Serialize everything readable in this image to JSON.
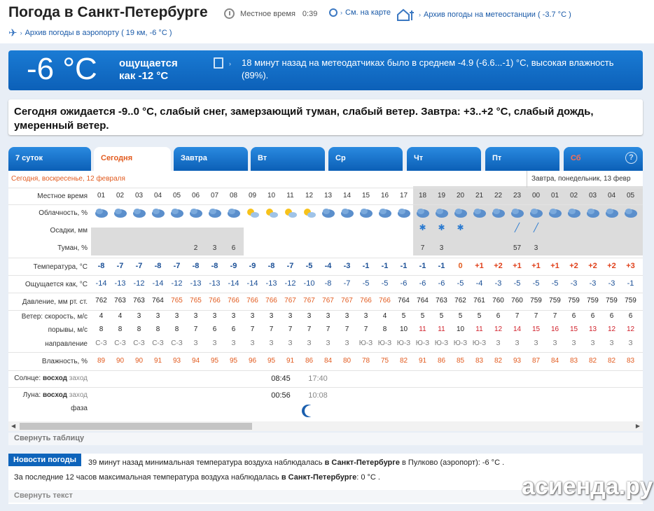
{
  "header": {
    "title": "Погода в Санкт-Петербурге",
    "local_time_label": "Местное время",
    "local_time": "0:39",
    "map_link": "См. на карте",
    "station_archive": "Архив погоды на метеостанции ( -3.7 °C )",
    "airport_archive": "Архив погоды в аэропорту ( 19 км, -6 °C )"
  },
  "current": {
    "temp": "-6 °C",
    "feels_1": "ощущается",
    "feels_2": "как -12 °C",
    "sensor_text": "18 минут назад на метеодатчиках было в среднем -4.9 (-6.6...-1) °C, высокая влажность (89%)."
  },
  "forecast_text": "Сегодня ожидается -9..0 °C, слабый снег, замерзающий туман, слабый ветер. Завтра: +3..+2 °C, слабый дождь, умеренный ветер.",
  "tabs": [
    {
      "label": "7 суток"
    },
    {
      "label": "Сегодня"
    },
    {
      "label": "Завтра"
    },
    {
      "label": "Вт"
    },
    {
      "label": "Ср"
    },
    {
      "label": "Чт"
    },
    {
      "label": "Пт"
    },
    {
      "label": "Сб"
    }
  ],
  "help_icon": "?",
  "day_today": "Сегодня, воскресенье, 12 февраля",
  "day_tomorrow": "Завтра, понедельник, 13 февр",
  "row_labels": {
    "time": "Местное время",
    "cloud": "Облачность, %",
    "precip": "Осадки, мм",
    "fog": "Туман, %",
    "temp": "Температура, °C",
    "feels": "Ощущается как, °C",
    "press": "Давление, мм рт. ст.",
    "wind": "Ветер: скорость, м/с",
    "gust": "порывы, м/с",
    "dir": "направление",
    "hum": "Влажность, %",
    "sun": "Солнце:",
    "sun_rise": "восход",
    "sun_set": "заход",
    "moon": "Луна:",
    "moon_rise": "восход",
    "moon_set": "заход",
    "moon_phase": "фаза"
  },
  "hours": [
    "01",
    "02",
    "03",
    "04",
    "05",
    "06",
    "07",
    "08",
    "09",
    "10",
    "11",
    "12",
    "13",
    "14",
    "15",
    "16",
    "17",
    "18",
    "19",
    "20",
    "21",
    "22",
    "23",
    "00",
    "01",
    "02",
    "03",
    "04",
    "05"
  ],
  "fog": [
    "",
    "",
    "",
    "",
    "",
    "2",
    "3",
    "6",
    "",
    "",
    "",
    "",
    "",
    "",
    "",
    "",
    "",
    "7",
    "3",
    "",
    "",
    "",
    "57",
    "3",
    "",
    "",
    "",
    "",
    ""
  ],
  "temp": [
    "-8",
    "-7",
    "-7",
    "-8",
    "-7",
    "-8",
    "-8",
    "-9",
    "-9",
    "-8",
    "-7",
    "-5",
    "-4",
    "-3",
    "-1",
    "-1",
    "-1",
    "-1",
    "-1",
    "0",
    "+1",
    "+2",
    "+1",
    "+1",
    "+1",
    "+2",
    "+2",
    "+2",
    "+3"
  ],
  "feels": [
    "-14",
    "-13",
    "-12",
    "-14",
    "-12",
    "-13",
    "-13",
    "-14",
    "-14",
    "-13",
    "-12",
    "-10",
    "-8",
    "-7",
    "-5",
    "-5",
    "-6",
    "-6",
    "-6",
    "-5",
    "-4",
    "-3",
    "-5",
    "-5",
    "-5",
    "-3",
    "-3",
    "-3",
    "-1"
  ],
  "press": [
    "762",
    "763",
    "763",
    "764",
    "765",
    "765",
    "766",
    "766",
    "766",
    "766",
    "767",
    "767",
    "767",
    "767",
    "766",
    "766",
    "764",
    "764",
    "763",
    "762",
    "761",
    "760",
    "760",
    "759",
    "759",
    "759",
    "759",
    "759",
    "759"
  ],
  "wind": [
    "4",
    "4",
    "3",
    "3",
    "3",
    "3",
    "3",
    "3",
    "3",
    "3",
    "3",
    "3",
    "3",
    "3",
    "3",
    "4",
    "5",
    "5",
    "5",
    "5",
    "5",
    "6",
    "7",
    "7",
    "7",
    "6",
    "6",
    "6",
    "6"
  ],
  "gust": [
    "8",
    "8",
    "8",
    "8",
    "8",
    "7",
    "6",
    "6",
    "7",
    "7",
    "7",
    "7",
    "7",
    "7",
    "7",
    "8",
    "10",
    "11",
    "11",
    "10",
    "11",
    "12",
    "14",
    "15",
    "16",
    "15",
    "13",
    "12",
    "12"
  ],
  "dir": [
    "С-З",
    "С-З",
    "С-З",
    "С-З",
    "С-З",
    "З",
    "З",
    "З",
    "З",
    "З",
    "З",
    "З",
    "З",
    "З",
    "Ю-З",
    "Ю-З",
    "Ю-З",
    "Ю-З",
    "Ю-З",
    "Ю-З",
    "Ю-З",
    "З",
    "З",
    "З",
    "З",
    "З",
    "З",
    "З",
    "З"
  ],
  "hum": [
    "89",
    "90",
    "90",
    "91",
    "93",
    "94",
    "95",
    "95",
    "96",
    "95",
    "91",
    "86",
    "84",
    "80",
    "78",
    "75",
    "82",
    "91",
    "86",
    "85",
    "83",
    "82",
    "93",
    "87",
    "84",
    "83",
    "82",
    "82",
    "83"
  ],
  "sunrise": "08:45",
  "sunset": "17:40",
  "moonrise": "00:56",
  "moonset": "10:08",
  "collapse_table": "Свернуть таблицу",
  "news": {
    "tab": "Новости погоды",
    "line1_a": "39 минут назад минимальная температура воздуха наблюдалась ",
    "line1_b": "в Санкт-Петербурге",
    "line1_c": " в Пулково (аэропорт): -6 °C .",
    "line2_a": "За последние 12 часов максимальная температура воздуха наблюдалась ",
    "line2_b": "в Санкт-Петербурге",
    "line2_c": ": 0 °C .",
    "collapse": "Свернуть текст"
  },
  "watermark": "асиенда.ру",
  "colors": {
    "brand_blue": "#0e64bb",
    "warm": "#e25b1f",
    "accent_link": "#1a5aa8"
  }
}
